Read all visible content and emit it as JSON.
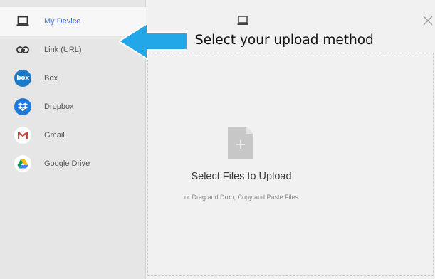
{
  "sidebar": {
    "items": [
      {
        "label": "My Device",
        "icon": "laptop-icon",
        "active": true
      },
      {
        "label": "Link (URL)",
        "icon": "link-icon",
        "active": false
      },
      {
        "label": "Box",
        "icon": "box-icon",
        "active": false
      },
      {
        "label": "Dropbox",
        "icon": "dropbox-icon",
        "active": false
      },
      {
        "label": "Gmail",
        "icon": "gmail-icon",
        "active": false
      },
      {
        "label": "Google Drive",
        "icon": "google-drive-icon",
        "active": false
      }
    ],
    "box_logo_text": "box"
  },
  "annotation": {
    "text": "Select your upload method",
    "arrow_color": "#22a7e8"
  },
  "dropzone": {
    "title": "Select Files to Upload",
    "subtitle": "or Drag and Drop, Copy and Paste Files",
    "icon": "file-add-icon"
  },
  "header": {
    "source_icon": "laptop-icon",
    "close_icon": "close-icon"
  },
  "colors": {
    "sidebar_bg": "#e6e6e6",
    "active_item_bg": "#f7f7f7",
    "active_label": "#3f6bd6",
    "main_bg": "#f1f1f1",
    "box_blue": "#1e79c6",
    "dropbox_blue": "#1f7bd8",
    "gmail_red": "#d44638"
  }
}
